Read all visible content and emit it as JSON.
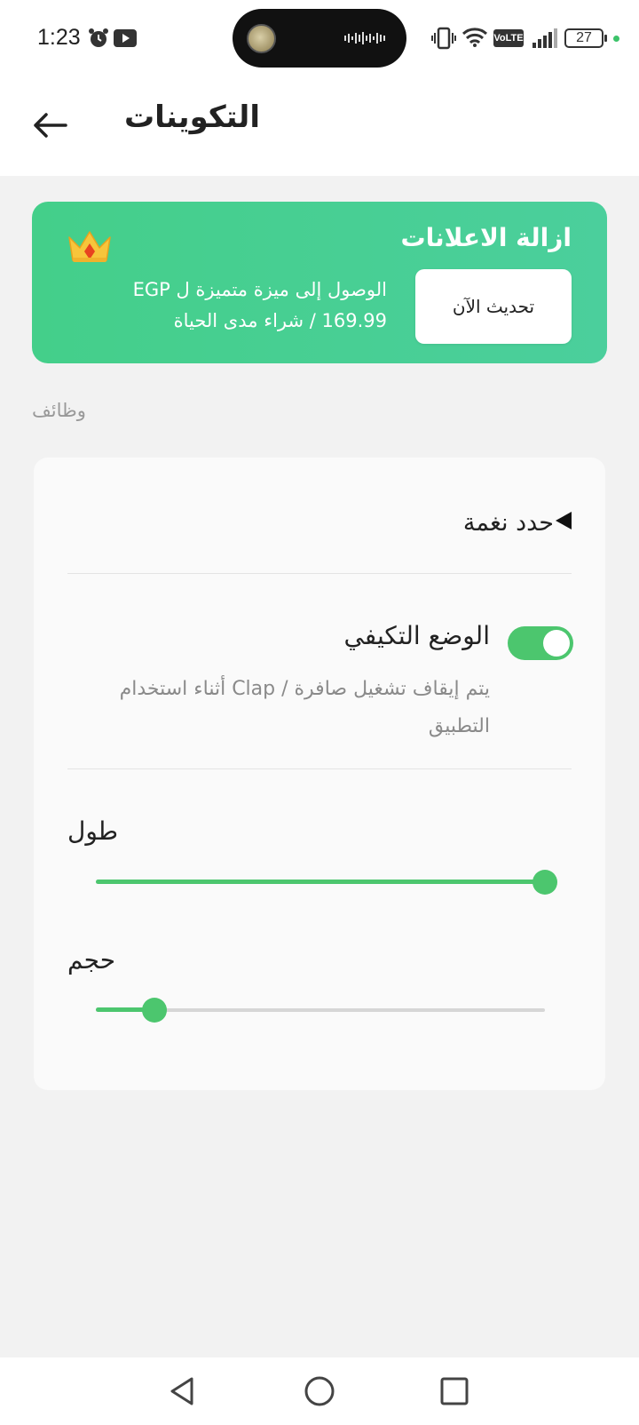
{
  "status_bar": {
    "time": "1:23",
    "battery": "27",
    "network_badge": "VoLTE",
    "icons": [
      "alarm-icon",
      "youtube-icon",
      "vibrate-icon",
      "wifi-icon",
      "signal-icon",
      "battery-icon"
    ]
  },
  "app_bar": {
    "title": "التكوينات",
    "back_icon": "arrow-left-icon"
  },
  "banner": {
    "title": "ازالة الاعلانات",
    "description_line1": "الوصول إلى ميزة متميزة ل EGP",
    "description_line2": "169.99  /  شراء مدى الحياة",
    "button_label": "تحديث الآن",
    "icon": "crown-icon",
    "color": "#4ccf93"
  },
  "section": {
    "label": "وظائف"
  },
  "settings": {
    "tone_label": "حدد نغمة",
    "adaptive_title": "الوضع التكيفي",
    "adaptive_description": "يتم إيقاف تشغيل صافرة / Clap أثناء استخدام التطبيق",
    "adaptive_enabled": true,
    "length_label": "طول",
    "length_value": 1.0,
    "volume_label": "حجم",
    "volume_value": 0.13,
    "accent_color": "#4cc66e"
  },
  "nav_bar": {
    "icons": [
      "back-triangle-icon",
      "home-circle-icon",
      "recents-square-icon"
    ]
  }
}
